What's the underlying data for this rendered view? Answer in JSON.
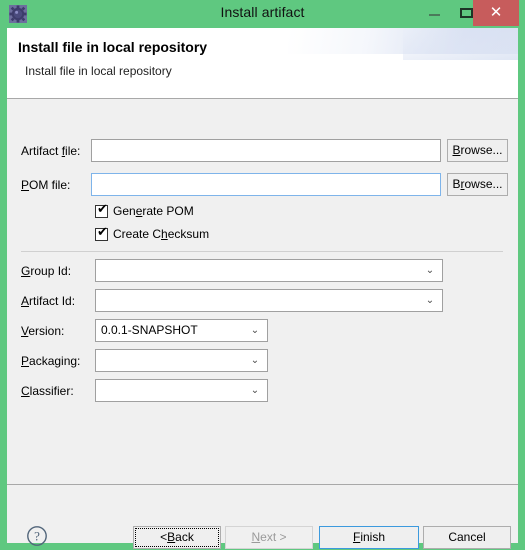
{
  "window": {
    "title": "Install artifact",
    "icon": "gear-icon",
    "accent_green": "#5fc880",
    "close_red": "#c75c5c",
    "controls": {
      "minimize": "–",
      "maximize": "□",
      "close": "✕"
    }
  },
  "banner": {
    "title": "Install file in local repository",
    "subtitle": "Install file in local repository"
  },
  "form": {
    "artifact_file": {
      "label_pre": "Artifact ",
      "label_mn": "f",
      "label_post": "ile:",
      "value": "",
      "placeholder": "",
      "browse_label_pre": "",
      "browse_mn": "B",
      "browse_label_post": "rowse..."
    },
    "pom_file": {
      "label_pre": "",
      "label_mn": "P",
      "label_post": "OM file:",
      "value": "",
      "placeholder": "",
      "browse_label_pre": "B",
      "browse_mn": "r",
      "browse_label_post": "owse..."
    },
    "generate_pom": {
      "label_pre": "Gen",
      "label_mn": "e",
      "label_post": "rate POM",
      "checked": true,
      "check_glyph": "✔"
    },
    "create_checksum": {
      "label_pre": "Create C",
      "label_mn": "h",
      "label_post": "ecksum",
      "checked": true,
      "check_glyph": "✔"
    },
    "group_id": {
      "label_pre": "",
      "label_mn": "G",
      "label_post": "roup Id:",
      "value": "",
      "arrow": "⌄"
    },
    "artifact_id": {
      "label_pre": "",
      "label_mn": "A",
      "label_post": "rtifact Id:",
      "value": "",
      "arrow": "⌄"
    },
    "version": {
      "label_pre": "",
      "label_mn": "V",
      "label_post": "ersion:",
      "value": "0.0.1-SNAPSHOT",
      "arrow": "⌄"
    },
    "packaging": {
      "label_pre": "",
      "label_mn": "P",
      "label_post": "ackaging:",
      "value": "",
      "arrow": "⌄"
    },
    "classifier": {
      "label_pre": "",
      "label_mn": "C",
      "label_post": "lassifier:",
      "value": "",
      "arrow": "⌄"
    }
  },
  "buttonbar": {
    "help": "?",
    "back": {
      "pre": "< ",
      "mn": "B",
      "post": "ack"
    },
    "next": {
      "pre": "",
      "mn": "N",
      "post": "ext >",
      "enabled": false
    },
    "finish": {
      "pre": "",
      "mn": "F",
      "post": "inish",
      "is_default": true
    },
    "cancel": {
      "pre": "",
      "mn": "",
      "post": "Cancel"
    }
  }
}
